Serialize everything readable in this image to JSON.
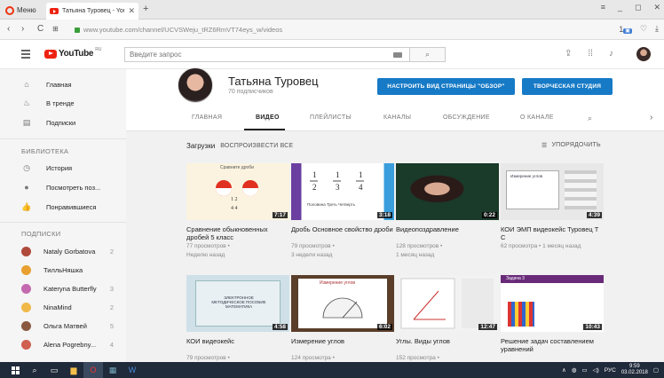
{
  "browser": {
    "menu_label": "Меню",
    "tab_title": "Татьяна Туровец - YouTube",
    "url": "www.youtube.com/channel/UCVSWeju_tRZ6RmVT74eys_w/videos",
    "notif_count": "1"
  },
  "yt": {
    "logo": "YouTube",
    "region": "RU",
    "search_placeholder": "Введите запрос"
  },
  "sidebar": {
    "nav": [
      {
        "label": "Главная",
        "icon": "home-icon"
      },
      {
        "label": "В тренде",
        "icon": "trending-icon"
      },
      {
        "label": "Подписки",
        "icon": "subscriptions-icon"
      }
    ],
    "library_heading": "БИБЛИОТЕКА",
    "library": [
      {
        "label": "История",
        "icon": "history-icon"
      },
      {
        "label": "Посмотреть поз...",
        "icon": "watch-later-icon"
      },
      {
        "label": "Понравившиеся",
        "icon": "liked-icon"
      }
    ],
    "subs_heading": "ПОДПИСКИ",
    "subs": [
      {
        "name": "Nataly Gorbatova",
        "count": "2",
        "color": "#b04a3a"
      },
      {
        "name": "ТилльНяшка",
        "count": "",
        "color": "#e8a030"
      },
      {
        "name": "Kateryna Butterfly",
        "count": "3",
        "color": "#c46ab0"
      },
      {
        "name": "NinaMind",
        "count": "2",
        "color": "#f0b848"
      },
      {
        "name": "Ольга Матвей",
        "count": "5",
        "color": "#8a5a40"
      },
      {
        "name": "Alena Pogrebny...",
        "count": "4",
        "color": "#d06050"
      }
    ]
  },
  "channel": {
    "name": "Татьяна Туровец",
    "subs": "70 подписчиков",
    "btn_customize": "НАСТРОИТЬ ВИД СТРАНИЦЫ \"ОБЗОР\"",
    "btn_studio": "ТВОРЧЕСКАЯ СТУДИЯ",
    "tabs": [
      "ГЛАВНАЯ",
      "ВИДЕО",
      "ПЛЕЙЛИСТЫ",
      "КАНАЛЫ",
      "ОБСУЖДЕНИЕ",
      "О КАНАЛЕ"
    ],
    "uploads_label": "Загрузки",
    "play_all": "ВОСПРОИЗВЕСТИ ВСЕ",
    "sort_label": "УПОРЯДОЧИТЬ"
  },
  "videos": [
    {
      "title": "Сравнение обыкновенных дробей 5 класс",
      "views": "77 просмотров •",
      "date": "Неделю назад",
      "duration": "7:17",
      "thumb_text": "Сравните дроби"
    },
    {
      "title": "Дробь Основное свойство дроби",
      "views": "79 просмотров •",
      "date": "3 недели назад",
      "duration": "3:18",
      "thumb_text": "Половина  Треть  Четверть"
    },
    {
      "title": "Видеопоздравление",
      "views": "128 просмотров •",
      "date": "1 месяц назад",
      "duration": "0:22",
      "thumb_text": ""
    },
    {
      "title": "КОИ ЭМП видеокейс Туровец Т С",
      "views": "62 просмотра • 1 месяц назад",
      "date": "",
      "duration": "4:39",
      "thumb_text": "Измерение углов"
    },
    {
      "title": "КОИ видеокейс",
      "views": "79 просмотров •",
      "date": "",
      "duration": "4:58",
      "thumb_text": "ЭЛЕКТРОННОЕ МЕТОДИЧЕСКОЕ ПОСОБИЕ МАТЕМАТИКА"
    },
    {
      "title": "Измерение углов",
      "views": "124 просмотра •",
      "date": "",
      "duration": "6:02",
      "thumb_text": "Измерение углов"
    },
    {
      "title": "Углы. Виды углов",
      "views": "152 просмотра •",
      "date": "",
      "duration": "12:47",
      "thumb_text": ""
    },
    {
      "title": "Решение задач составлением уравнений",
      "views": "",
      "date": "",
      "duration": "10:43",
      "thumb_text": "Задача 3"
    }
  ],
  "taskbar": {
    "lang": "РУС",
    "time": "9:59",
    "date": "03.02.2018"
  }
}
